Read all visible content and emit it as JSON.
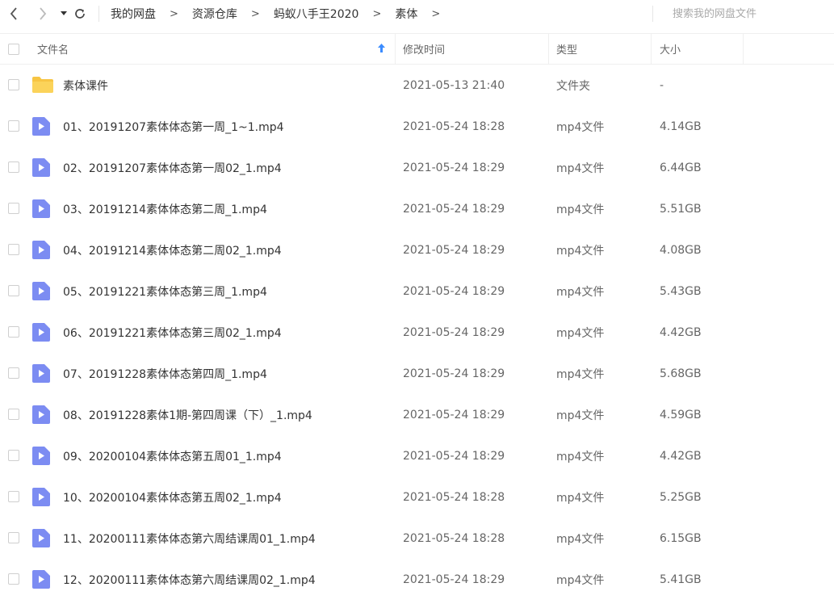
{
  "toolbar": {
    "back_icon": "chevron-left-icon",
    "forward_icon": "chevron-right-icon",
    "history_icon": "caret-down-icon",
    "refresh_icon": "refresh-icon"
  },
  "breadcrumb": [
    "我的网盘",
    "资源仓库",
    "蚂蚁八手王2020",
    "素体"
  ],
  "breadcrumb_separator": ">",
  "search": {
    "placeholder": "搜索我的网盘文件"
  },
  "columns": {
    "name": "文件名",
    "modified": "修改时间",
    "type": "类型",
    "size": "大小",
    "sort_icon": "arrow-up-icon"
  },
  "colors": {
    "accent": "#3b8cff",
    "folder": "#f7c543",
    "video_icon": "#7c8cf2"
  },
  "files": [
    {
      "icon": "folder-icon",
      "name": "素体课件",
      "modified": "2021-05-13 21:40",
      "type": "文件夹",
      "size": "-"
    },
    {
      "icon": "video-file-icon",
      "name": "01、20191207素体体态第一周_1~1.mp4",
      "modified": "2021-05-24 18:28",
      "type": "mp4文件",
      "size": "4.14GB"
    },
    {
      "icon": "video-file-icon",
      "name": "02、20191207素体体态第一周02_1.mp4",
      "modified": "2021-05-24 18:29",
      "type": "mp4文件",
      "size": "6.44GB"
    },
    {
      "icon": "video-file-icon",
      "name": "03、20191214素体体态第二周_1.mp4",
      "modified": "2021-05-24 18:29",
      "type": "mp4文件",
      "size": "5.51GB"
    },
    {
      "icon": "video-file-icon",
      "name": "04、20191214素体体态第二周02_1.mp4",
      "modified": "2021-05-24 18:29",
      "type": "mp4文件",
      "size": "4.08GB"
    },
    {
      "icon": "video-file-icon",
      "name": "05、20191221素体体态第三周_1.mp4",
      "modified": "2021-05-24 18:29",
      "type": "mp4文件",
      "size": "5.43GB"
    },
    {
      "icon": "video-file-icon",
      "name": "06、20191221素体体态第三周02_1.mp4",
      "modified": "2021-05-24 18:29",
      "type": "mp4文件",
      "size": "4.42GB"
    },
    {
      "icon": "video-file-icon",
      "name": "07、20191228素体体态第四周_1.mp4",
      "modified": "2021-05-24 18:29",
      "type": "mp4文件",
      "size": "5.68GB"
    },
    {
      "icon": "video-file-icon",
      "name": "08、20191228素体1期-第四周课（下）_1.mp4",
      "modified": "2021-05-24 18:29",
      "type": "mp4文件",
      "size": "4.59GB"
    },
    {
      "icon": "video-file-icon",
      "name": "09、20200104素体体态第五周01_1.mp4",
      "modified": "2021-05-24 18:29",
      "type": "mp4文件",
      "size": "4.42GB"
    },
    {
      "icon": "video-file-icon",
      "name": "10、20200104素体体态第五周02_1.mp4",
      "modified": "2021-05-24 18:28",
      "type": "mp4文件",
      "size": "5.25GB"
    },
    {
      "icon": "video-file-icon",
      "name": "11、20200111素体体态第六周结课周01_1.mp4",
      "modified": "2021-05-24 18:28",
      "type": "mp4文件",
      "size": "6.15GB"
    },
    {
      "icon": "video-file-icon",
      "name": "12、20200111素体体态第六周结课周02_1.mp4",
      "modified": "2021-05-24 18:29",
      "type": "mp4文件",
      "size": "5.41GB"
    }
  ]
}
